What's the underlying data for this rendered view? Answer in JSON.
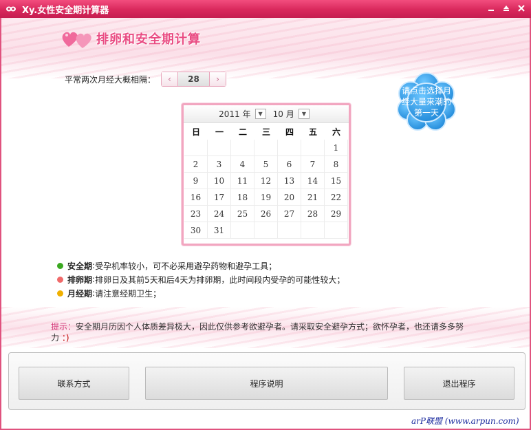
{
  "window": {
    "title": "Xy.女性安全期计算器",
    "controls": [
      "minimize",
      "restore",
      "close"
    ]
  },
  "header": {
    "logo_text": "排卵和安全期计算"
  },
  "cycle": {
    "label": "平常两次月经大概相隔：",
    "value": "28",
    "decrement_icon": "chevron-left-icon",
    "increment_icon": "chevron-right-icon"
  },
  "cloud_hint": "请点击选择月经大量来潮的第一天",
  "calendar": {
    "year": "2011",
    "year_suffix": "年",
    "month": "10",
    "month_suffix": "月",
    "weekdays": [
      "日",
      "一",
      "二",
      "三",
      "四",
      "五",
      "六"
    ],
    "days": [
      "",
      "",
      "",
      "",
      "",
      "",
      "1",
      "2",
      "3",
      "4",
      "5",
      "6",
      "7",
      "8",
      "9",
      "10",
      "11",
      "12",
      "13",
      "14",
      "15",
      "16",
      "17",
      "18",
      "19",
      "20",
      "21",
      "22",
      "23",
      "24",
      "25",
      "26",
      "27",
      "28",
      "29",
      "30",
      "31",
      "",
      "",
      "",
      "",
      ""
    ]
  },
  "legend": [
    {
      "name": "安全期",
      "sep": ":",
      "desc": "受孕机率较小，可不必采用避孕药物和避孕工具；",
      "color": "#3aa820"
    },
    {
      "name": "排卵期",
      "sep": ":",
      "desc": "排卵日及其前5天和后4天为排卵期，此时间段内受孕的可能性较大；",
      "color": "#f06a6a"
    },
    {
      "name": "月经期",
      "sep": ":",
      "desc": "请注意经期卫生；",
      "color": "#f0b000"
    }
  ],
  "tip": {
    "label": "提示：",
    "text": "安全期月历因个人体质差异极大，因此仅供参考欲避孕者。请采取安全避孕方式；欲怀孕者，也还请多多努力",
    "smile": "：)"
  },
  "buttons": {
    "contact": "联系方式",
    "about": "程序说明",
    "exit": "退出程序"
  },
  "watermark": "arP联盟 (www.arpun.com)",
  "colors": {
    "title_bar": "#d9285c",
    "accent": "#e94b82",
    "calendar_border": "#f2a6c0",
    "cloud": "#2e9be6"
  }
}
